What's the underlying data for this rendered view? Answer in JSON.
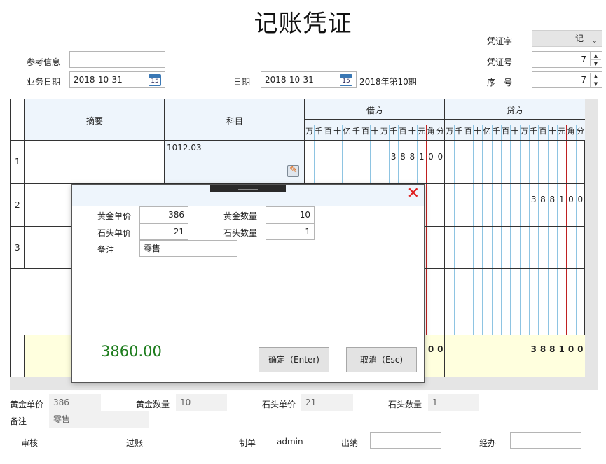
{
  "title": "记账凭证",
  "header": {
    "ref_label": "参考信息",
    "ref_value": "",
    "biz_date_label": "业务日期",
    "biz_date_value": "2018-10-31",
    "date_label": "日期",
    "date_value": "2018-10-31",
    "cal_day": "15",
    "period_text": "2018年第10期",
    "voucher_type_label": "凭证字",
    "voucher_type_value": "记",
    "voucher_no_label": "凭证号",
    "voucher_no_value": "7",
    "seq_label": "序　号",
    "seq_value": "7"
  },
  "grid": {
    "col_summary": "摘要",
    "col_subject": "科目",
    "col_debit": "借方",
    "col_credit": "贷方",
    "unit_labels": [
      "万",
      "千",
      "百",
      "十",
      "亿",
      "千",
      "百",
      "十",
      "万",
      "千",
      "百",
      "十",
      "元",
      "角",
      "分"
    ],
    "rows": [
      {
        "no": "1",
        "summary": "",
        "subject": "1012.03",
        "debit": "388100",
        "credit": ""
      },
      {
        "no": "2",
        "summary": "",
        "subject": "",
        "debit": "",
        "credit": "388100"
      },
      {
        "no": "3",
        "summary": "",
        "subject": "",
        "debit": "",
        "credit": ""
      }
    ],
    "total_debit_visible": "00",
    "total_credit": "388100"
  },
  "dialog": {
    "gold_price_label": "黄金单价",
    "gold_price_value": "386",
    "gold_qty_label": "黄金数量",
    "gold_qty_value": "10",
    "stone_price_label": "石头单价",
    "stone_price_value": "21",
    "stone_qty_label": "石头数量",
    "stone_qty_value": "1",
    "note_label": "备注",
    "note_value": "零售",
    "total": "3860.00",
    "ok_label": "确定（Enter)",
    "cancel_label": "取消（Esc)"
  },
  "footer": {
    "gold_price_label": "黄金单价",
    "gold_price_value": "386",
    "gold_qty_label": "黄金数量",
    "gold_qty_value": "10",
    "stone_price_label": "石头单价",
    "stone_price_value": "21",
    "stone_qty_label": "石头数量",
    "stone_qty_value": "1",
    "note_label": "备注",
    "note_value": "零售",
    "audit_label": "审核",
    "post_label": "过账",
    "maker_label": "制单",
    "maker_value": "admin",
    "cashier_label": "出纳",
    "cashier_value": "",
    "handler_label": "经办",
    "handler_value": ""
  },
  "colors": {
    "accent_blue": "#8ec4e2",
    "yuan_divider_red": "#c02020",
    "total_row_bg": "#ffffde",
    "total_text_green": "#1e7d1e",
    "close_red": "#e02020"
  },
  "icons": [
    "calendar-icon",
    "spinner-arrows-icon",
    "chevron-down-icon",
    "edit-icon",
    "close-icon"
  ]
}
